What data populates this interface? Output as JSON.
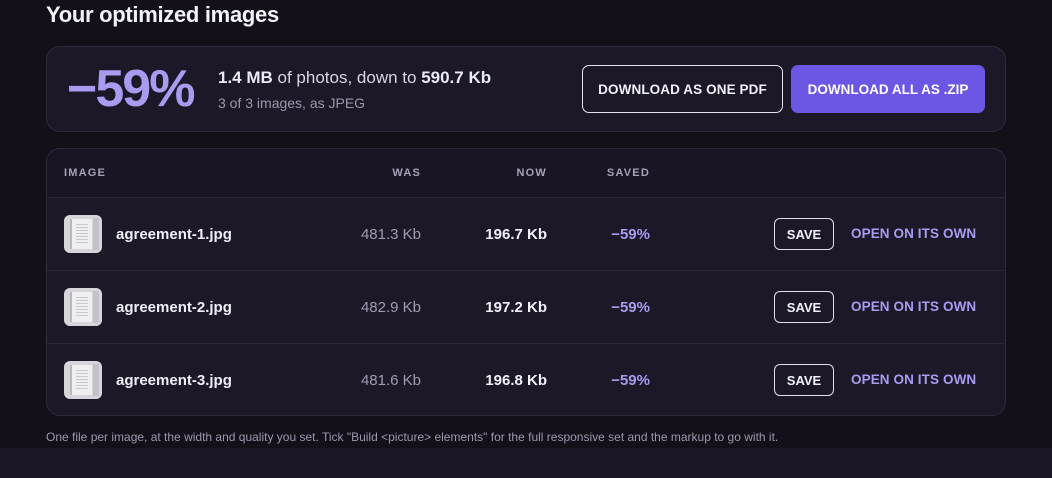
{
  "page": {
    "title": "Your optimized images",
    "footnote": "One file per image, at the width and quality you set. Tick \"Build <picture> elements\" for the full responsive set and the markup to go with it."
  },
  "summary": {
    "percent": "−59%",
    "original_size": "1.4 MB",
    "text_middle": " of photos, down to ",
    "new_size": "590.7 Kb",
    "sub": "3 of 3 images, as JPEG",
    "download_pdf_label": "DOWNLOAD AS ONE PDF",
    "download_zip_label": "DOWNLOAD ALL AS .ZIP"
  },
  "table": {
    "headers": {
      "image": "IMAGE",
      "was": "WAS",
      "now": "NOW",
      "saved": "SAVED"
    },
    "rows": [
      {
        "name": "agreement-1.jpg",
        "was": "481.3 Kb",
        "now": "196.7 Kb",
        "saved": "−59%",
        "save_label": "SAVE",
        "open_label": "OPEN ON ITS OWN"
      },
      {
        "name": "agreement-2.jpg",
        "was": "482.9 Kb",
        "now": "197.2 Kb",
        "saved": "−59%",
        "save_label": "SAVE",
        "open_label": "OPEN ON ITS OWN"
      },
      {
        "name": "agreement-3.jpg",
        "was": "481.6 Kb",
        "now": "196.8 Kb",
        "saved": "−59%",
        "save_label": "SAVE",
        "open_label": "OPEN ON ITS OWN"
      }
    ]
  },
  "colors": {
    "accent": "#a99bf0",
    "primary_button": "#6c56e4",
    "background": "#141019",
    "card": "#1c1828"
  }
}
